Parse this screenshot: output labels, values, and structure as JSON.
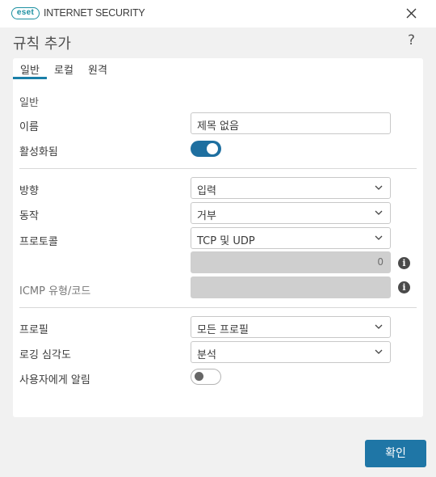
{
  "window": {
    "logo_text": "eset",
    "product": "INTERNET SECURITY",
    "close_icon": "close-icon"
  },
  "header": {
    "title": "규칙 추가",
    "help": "?"
  },
  "tabs": [
    {
      "label": "일반",
      "active": true
    },
    {
      "label": "로컬",
      "active": false
    },
    {
      "label": "원격",
      "active": false
    }
  ],
  "general": {
    "section_label": "일반",
    "name_label": "이름",
    "name_value": "제목 없음",
    "enabled_label": "활성화됨",
    "enabled": true
  },
  "rule": {
    "direction_label": "방향",
    "direction_value": "입력",
    "action_label": "동작",
    "action_value": "거부",
    "protocol_label": "프로토콜",
    "protocol_value": "TCP 및 UDP",
    "protocol_number": "0",
    "icmp_label": "ICMP 유형/코드",
    "icmp_value": ""
  },
  "profile": {
    "profile_label": "프로필",
    "profile_value": "모든 프로필",
    "log_label": "로깅 심각도",
    "log_value": "분석",
    "notify_label": "사용자에게 알림",
    "notify": false
  },
  "footer": {
    "ok_label": "확인"
  },
  "colors": {
    "accent": "#1f76a6",
    "toggle_on": "#1e6fa0",
    "brand": "#1a8fa0",
    "background": "#f1f1f1"
  }
}
